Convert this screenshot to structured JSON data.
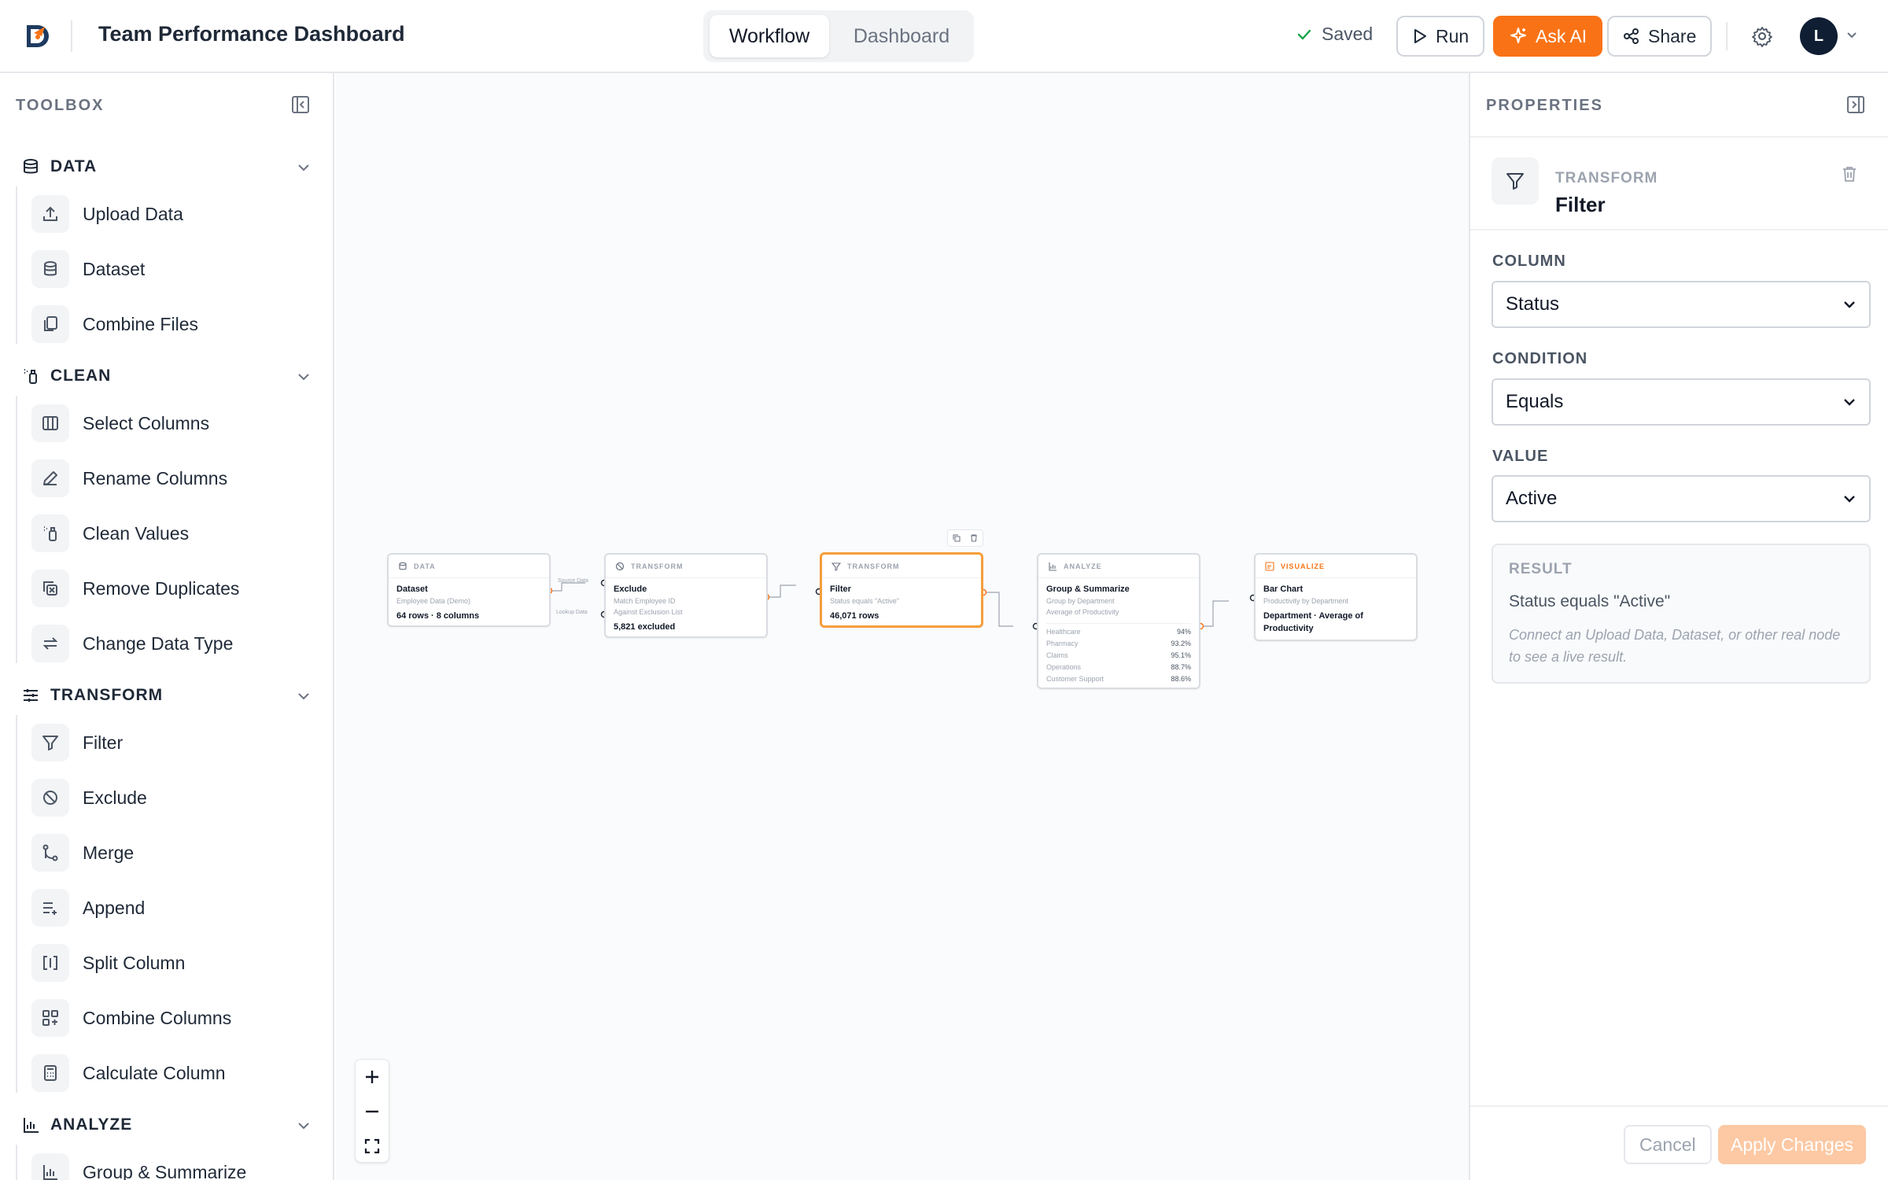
{
  "header": {
    "title": "Team Performance Dashboard",
    "tabs": [
      "Workflow",
      "Dashboard"
    ],
    "active_tab": "Workflow",
    "saved_label": "Saved",
    "run_label": "Run",
    "ask_ai_label": "Ask AI",
    "share_label": "Share",
    "avatar_initial": "L"
  },
  "toolbox": {
    "title": "TOOLBOX",
    "sections": [
      {
        "label": "DATA",
        "icon": "database-icon",
        "items": [
          "Upload Data",
          "Dataset",
          "Combine Files"
        ]
      },
      {
        "label": "CLEAN",
        "icon": "spray-icon",
        "items": [
          "Select Columns",
          "Rename Columns",
          "Clean Values",
          "Remove Duplicates",
          "Change Data Type"
        ]
      },
      {
        "label": "TRANSFORM",
        "icon": "sliders-icon",
        "items": [
          "Filter",
          "Exclude",
          "Merge",
          "Append",
          "Split Column",
          "Combine Columns",
          "Calculate Column"
        ]
      },
      {
        "label": "ANALYZE",
        "icon": "bar-chart-icon",
        "items": [
          "Group & Summarize"
        ]
      }
    ]
  },
  "canvas": {
    "nodes": {
      "dataset": {
        "category": "DATA",
        "title": "Dataset",
        "subtitle": "Employee Data (Demo)",
        "stat": "64 rows · 8 columns"
      },
      "exclude": {
        "category": "TRANSFORM",
        "title": "Exclude",
        "line1": "Match Employee ID",
        "line2": "Against Exclusion List",
        "stat": "5,821 excluded",
        "port_source": "Source Data",
        "port_lookup": "Lookup Data"
      },
      "filter": {
        "category": "TRANSFORM",
        "title": "Filter",
        "subtitle": "Status equals \"Active\"",
        "stat": "46,071 rows"
      },
      "group": {
        "category": "ANALYZE",
        "title": "Group & Summarize",
        "line1": "Group by Department",
        "line2": "Average of Productivity",
        "rows": [
          {
            "label": "Healthcare",
            "value": "94%"
          },
          {
            "label": "Pharmacy",
            "value": "93.2%"
          },
          {
            "label": "Claims",
            "value": "95.1%"
          },
          {
            "label": "Operations",
            "value": "88.7%"
          },
          {
            "label": "Customer Support",
            "value": "88.6%"
          }
        ]
      },
      "chart": {
        "category": "VISUALIZE",
        "title": "Bar Chart",
        "subtitle": "Productivity by Department",
        "stat": "Department · Average of Productivity"
      }
    }
  },
  "properties": {
    "title": "PROPERTIES",
    "node_type": "TRANSFORM",
    "node_name": "Filter",
    "column_label": "COLUMN",
    "column_value": "Status",
    "condition_label": "CONDITION",
    "condition_value": "Equals",
    "value_label": "VALUE",
    "value_value": "Active",
    "result_label": "RESULT",
    "result_text": "Status equals \"Active\"",
    "result_hint": "Connect an Upload Data, Dataset, or other real node to see a live result.",
    "cancel_label": "Cancel",
    "apply_label": "Apply Changes"
  },
  "colors": {
    "accent": "#f97316",
    "selected_border": "#f59e3a",
    "avatar_bg": "#0f1e33"
  }
}
